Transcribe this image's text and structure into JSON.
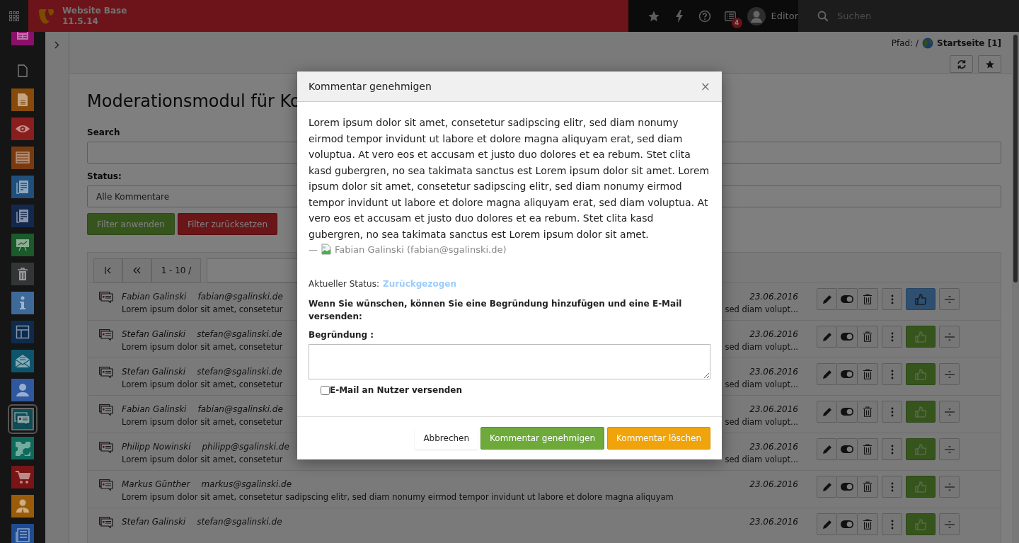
{
  "topbar": {
    "site_name": "Website Base",
    "version": "11.5.14",
    "notification_count": "4",
    "user": "Editor",
    "search": {
      "placeholder": "Suchen"
    }
  },
  "module_menu": [
    {
      "kind": "layout",
      "color": "#8c0f6b",
      "selected": false
    },
    {
      "kind": "page",
      "selected": false
    },
    {
      "kind": "doc",
      "color": "#874a0a",
      "selected": false
    },
    {
      "kind": "eye",
      "color": "#8a1d1d",
      "selected": false
    },
    {
      "kind": "list",
      "color": "#7a3a0f",
      "selected": false
    },
    {
      "kind": "report",
      "color": "#1f4f7a",
      "selected": false
    },
    {
      "kind": "report",
      "color": "#14284d",
      "selected": false
    },
    {
      "kind": "chart",
      "color": "#1b5a2b",
      "selected": false
    },
    {
      "kind": "trash",
      "color": "#333637",
      "selected": false
    },
    {
      "kind": "info",
      "color": "#3d6a99",
      "selected": false
    },
    {
      "kind": "grid",
      "color": "#0d2b4d",
      "selected": false
    },
    {
      "kind": "mail",
      "color": "#0d556b",
      "selected": false
    },
    {
      "kind": "user",
      "color": "#2f58a0",
      "selected": false
    },
    {
      "kind": "comments",
      "color": "#0e4d55",
      "selected": true
    },
    {
      "kind": "gear",
      "color": "#0e6a5a",
      "selected": false
    },
    {
      "kind": "cart",
      "color": "#7a1515",
      "selected": false
    },
    {
      "kind": "person",
      "color": "#9a5c08",
      "selected": false
    },
    {
      "kind": "news",
      "color": "#1f4b93",
      "selected": false
    }
  ],
  "docheader": {
    "path_label": "Pfad: /",
    "page": "Startseite [1]"
  },
  "content": {
    "title": "Moderationsmodul für Ko",
    "search_label": "Search",
    "status_label": "Status:",
    "status_value": "Alle Kommentare",
    "apply_button": "Filter anwenden",
    "reset_button": "Filter zurücksetzen",
    "page_range": "1 - 10 /"
  },
  "comments": [
    {
      "name": "Fabian Galinski",
      "email": "fabian@sgalinski.de",
      "date": "23.06.2016",
      "excerpt_start": "Lorem ipsum dolor sit amet, consetetur",
      "excerpt_end": "sed diam volupt...",
      "active": true
    },
    {
      "name": "Stefan Galinski",
      "email": "stefan@sgalinski.de",
      "date": "23.06.2016",
      "excerpt_start": "Lorem ipsum dolor sit amet, consetetur",
      "excerpt_end": "sed diam volupt...",
      "active": false
    },
    {
      "name": "Stefan Galinski",
      "email": "stefan@sgalinski.de",
      "date": "23.06.2016",
      "excerpt_start": "Lorem ipsum dolor sit amet, consetetur",
      "excerpt_end": "sed diam volupt...",
      "active": false
    },
    {
      "name": "Fabian Galinski",
      "email": "fabian@sgalinski.de",
      "date": "23.06.2016",
      "excerpt_start": "Lorem ipsum dolor sit amet, consetetur",
      "excerpt_end": "sed diam volupt...",
      "active": false
    },
    {
      "name": "Philipp Nowinski",
      "email": "philipp@sgalinski.de",
      "date": "23.06.2016",
      "excerpt_start": "Lorem ipsum dolor sit amet, consetetur",
      "excerpt_end": "sed diam volupt...",
      "active": false
    },
    {
      "name": "Markus Günther",
      "email": "markus@sgalinski.de",
      "date": "23.06.2016",
      "excerpt_start": "Lorem ipsum dolor sit amet, consetetur sadipscing elitr, sed diam nonumy eirmod tempor invidunt ut labore et dolore magna aliquyam",
      "active": false
    },
    {
      "name": "Stefan Galinski",
      "email": "stefan@sgalinski.de",
      "date": "23.06.2016",
      "active": false
    }
  ],
  "modal": {
    "title": "Kommentar genehmigen",
    "close": "×",
    "body": "Lorem ipsum dolor sit amet, consetetur sadipscing elitr, sed diam nonumy eirmod tempor invidunt ut labore et dolore magna aliquyam erat, sed diam voluptua. At vero eos et accusam et justo duo dolores et ea rebum. Stet clita kasd gubergren, no sea takimata sanctus est Lorem ipsum dolor sit amet. Lorem ipsum dolor sit amet, consetetur sadipscing elitr, sed diam nonumy eirmod tempor invidunt ut labore et dolore magna aliquyam erat, sed diam voluptua. At vero eos et accusam et justo duo dolores et ea rebum. Stet clita kasd gubergren, no sea takimata sanctus est Lorem ipsum dolor sit amet.",
    "author_prefix": "—",
    "author": "Fabian Galinski (fabian@sgalinski.de)",
    "status_label": "Aktueller Status:",
    "status_value": "Zurückgezogen",
    "hint": "Wenn Sie wünschen, können Sie eine Begründung hinzufügen und eine E-Mail versenden:",
    "reason_label": "Begründung :",
    "email_option": {
      "label": "E-Mail an Nutzer versenden",
      "checked": false
    },
    "cancel_button": "Abbrechen",
    "approve_button": "Kommentar genehmigen",
    "delete_button": "Kommentar löschen"
  }
}
